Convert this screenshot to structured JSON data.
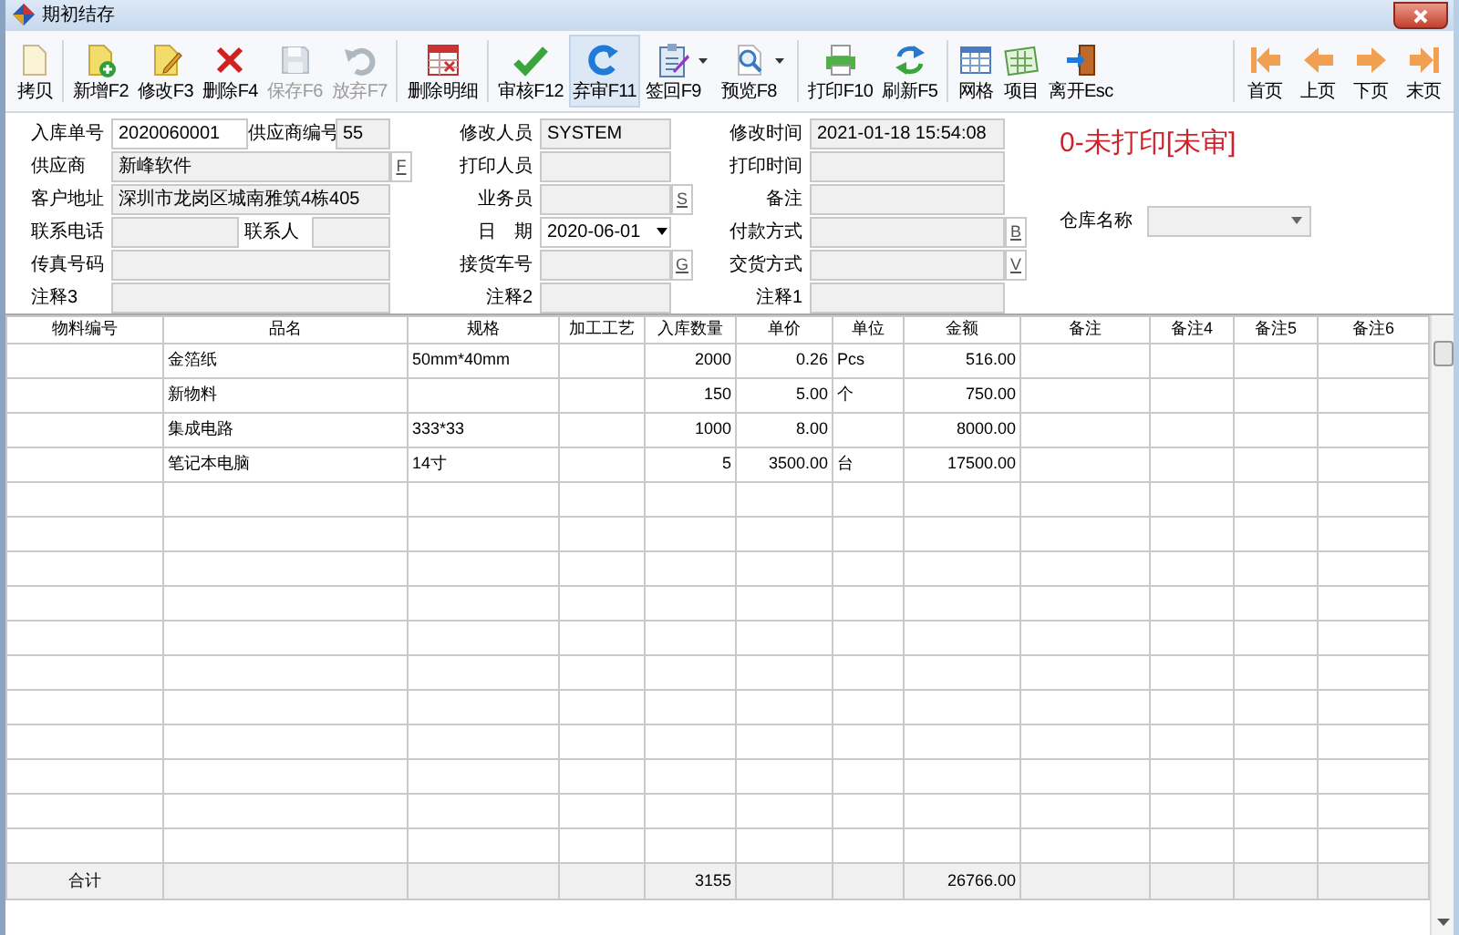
{
  "window": {
    "title": "期初结存"
  },
  "toolbar": [
    {
      "label": "拷贝",
      "disabled": false,
      "selected": false,
      "dropdown": false
    },
    {
      "label": "新增F2",
      "disabled": false,
      "selected": false,
      "dropdown": false
    },
    {
      "label": "修改F3",
      "disabled": false,
      "selected": false,
      "dropdown": false
    },
    {
      "label": "删除F4",
      "disabled": false,
      "selected": false,
      "dropdown": false
    },
    {
      "label": "保存F6",
      "disabled": true,
      "selected": false,
      "dropdown": false
    },
    {
      "label": "放弃F7",
      "disabled": true,
      "selected": false,
      "dropdown": false
    },
    {
      "label": "删除明细",
      "disabled": false,
      "selected": false,
      "dropdown": false
    },
    {
      "label": "审核F12",
      "disabled": false,
      "selected": false,
      "dropdown": false
    },
    {
      "label": "弃审F11",
      "disabled": false,
      "selected": true,
      "dropdown": false
    },
    {
      "label": "签回F9",
      "disabled": false,
      "selected": false,
      "dropdown": true
    },
    {
      "label": "预览F8",
      "disabled": false,
      "selected": false,
      "dropdown": true
    },
    {
      "label": "打印F10",
      "disabled": false,
      "selected": false,
      "dropdown": false
    },
    {
      "label": "刷新F5",
      "disabled": false,
      "selected": false,
      "dropdown": false
    },
    {
      "label": "网格",
      "disabled": false,
      "selected": false,
      "dropdown": false
    },
    {
      "label": "项目",
      "disabled": false,
      "selected": false,
      "dropdown": false
    },
    {
      "label": "离开Esc",
      "disabled": false,
      "selected": false,
      "dropdown": false
    }
  ],
  "nav": [
    {
      "label": "首页"
    },
    {
      "label": "上页"
    },
    {
      "label": "下页"
    },
    {
      "label": "末页"
    }
  ],
  "form": {
    "columns": [
      [
        {
          "fields": [
            {
              "label": "入库单号",
              "value": "2020060001",
              "editable": true
            },
            {
              "label": "供应商编号",
              "value": "55",
              "editable": false
            }
          ]
        },
        {
          "fields": [
            {
              "label": "供应商",
              "value": "新峰软件",
              "editable": false,
              "lookup": "F"
            }
          ]
        },
        {
          "fields": [
            {
              "label": "客户地址",
              "value": "深圳市龙岗区城南雅筑4栋405",
              "editable": false
            }
          ]
        },
        {
          "fields": [
            {
              "label": "联系电话",
              "editable": false
            },
            {
              "label": "联系人",
              "editable": false
            }
          ]
        },
        {
          "fields": [
            {
              "label": "传真号码",
              "editable": false
            }
          ]
        },
        {
          "fields": [
            {
              "label": "注释3",
              "editable": false
            }
          ]
        }
      ],
      [
        {
          "fields": [
            {
              "label": "修改人员",
              "value": "SYSTEM",
              "editable": false
            }
          ]
        },
        {
          "fields": [
            {
              "label": "打印人员",
              "editable": false
            }
          ]
        },
        {
          "fields": [
            {
              "label": "业务员",
              "editable": false,
              "lookup": "S"
            }
          ]
        },
        {
          "fields": [
            {
              "label": "日　期",
              "value": "2020-06-01",
              "editable": true,
              "kind": "date"
            }
          ]
        },
        {
          "fields": [
            {
              "label": "接货车号",
              "editable": false,
              "lookup": "G"
            }
          ]
        },
        {
          "fields": [
            {
              "label": "注释2",
              "editable": false
            }
          ]
        }
      ],
      [
        {
          "fields": [
            {
              "label": "修改时间",
              "value": "2021-01-18 15:54:08",
              "editable": false
            }
          ]
        },
        {
          "fields": [
            {
              "label": "打印时间",
              "editable": false
            }
          ]
        },
        {
          "fields": [
            {
              "label": "备注",
              "editable": false
            }
          ]
        },
        {
          "fields": [
            {
              "label": "付款方式",
              "editable": false,
              "lookup": "B"
            }
          ]
        },
        {
          "fields": [
            {
              "label": "交货方式",
              "editable": false,
              "lookup": "V"
            }
          ]
        },
        {
          "fields": [
            {
              "label": "注释1",
              "editable": false
            }
          ]
        }
      ]
    ],
    "status": "0-未打印[未审]",
    "warehouse": {
      "label": "仓库名称"
    }
  },
  "table": {
    "columns": [
      {
        "title": "物料编号",
        "total": "合计"
      },
      {
        "title": "品名"
      },
      {
        "title": "规格"
      },
      {
        "title": "加工工艺"
      },
      {
        "title": "入库数量",
        "total": "3155"
      },
      {
        "title": "单价"
      },
      {
        "title": "单位"
      },
      {
        "title": "金额",
        "total": "26766.00"
      },
      {
        "title": "备注"
      },
      {
        "title": "备注4"
      },
      {
        "title": "备注5"
      },
      {
        "title": "备注6"
      }
    ],
    "rows": [
      {
        "cells": [
          null,
          "金箔纸",
          "50mm*40mm",
          null,
          "2000",
          "0.26",
          "Pcs",
          "516.00",
          null,
          null,
          null,
          null
        ]
      },
      {
        "cells": [
          null,
          "新物料",
          null,
          null,
          "150",
          "5.00",
          "个",
          "750.00",
          null,
          null,
          null,
          null
        ]
      },
      {
        "cells": [
          null,
          "集成电路",
          "333*33",
          null,
          "1000",
          "8.00",
          null,
          "8000.00",
          null,
          null,
          null,
          null
        ]
      },
      {
        "cells": [
          null,
          "笔记本电脑",
          "14寸",
          null,
          "5",
          "3500.00",
          "台",
          "17500.00",
          null,
          null,
          null,
          null
        ]
      }
    ]
  }
}
